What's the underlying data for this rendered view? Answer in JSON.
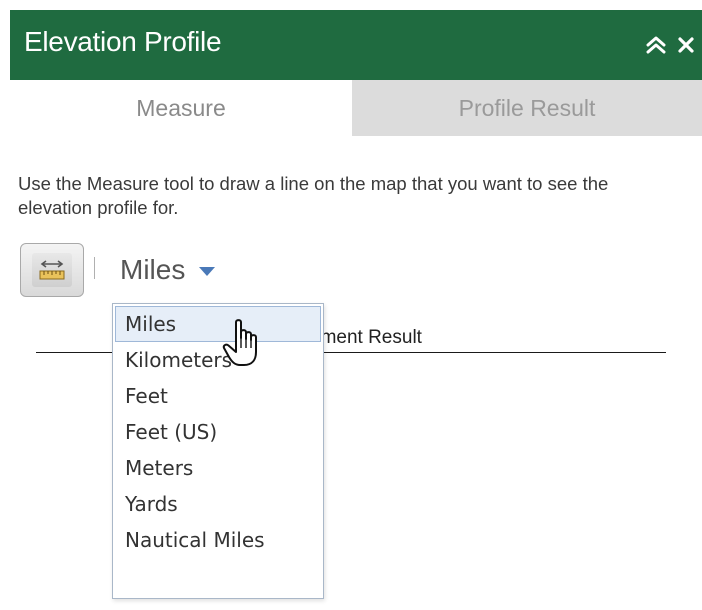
{
  "panel": {
    "title": "Elevation Profile",
    "collapse_icon": "double-chevron-up-icon",
    "close_icon": "close-icon",
    "header_color": "#1f6b40"
  },
  "tabs": [
    {
      "label": "Measure",
      "active": true
    },
    {
      "label": "Profile Result",
      "active": false
    }
  ],
  "instructions": "Use the Measure tool to draw a line on the map that you want to see the elevation profile for.",
  "measure_tool": {
    "icon": "ruler-distance-icon"
  },
  "unit_select": {
    "selected": "Miles",
    "options": [
      "Miles",
      "Kilometers",
      "Feet",
      "Feet (US)",
      "Meters",
      "Yards",
      "Nautical Miles"
    ],
    "highlighted": "Miles"
  },
  "result_label": "ement Result",
  "cursor_icon": "hand-pointer-icon"
}
